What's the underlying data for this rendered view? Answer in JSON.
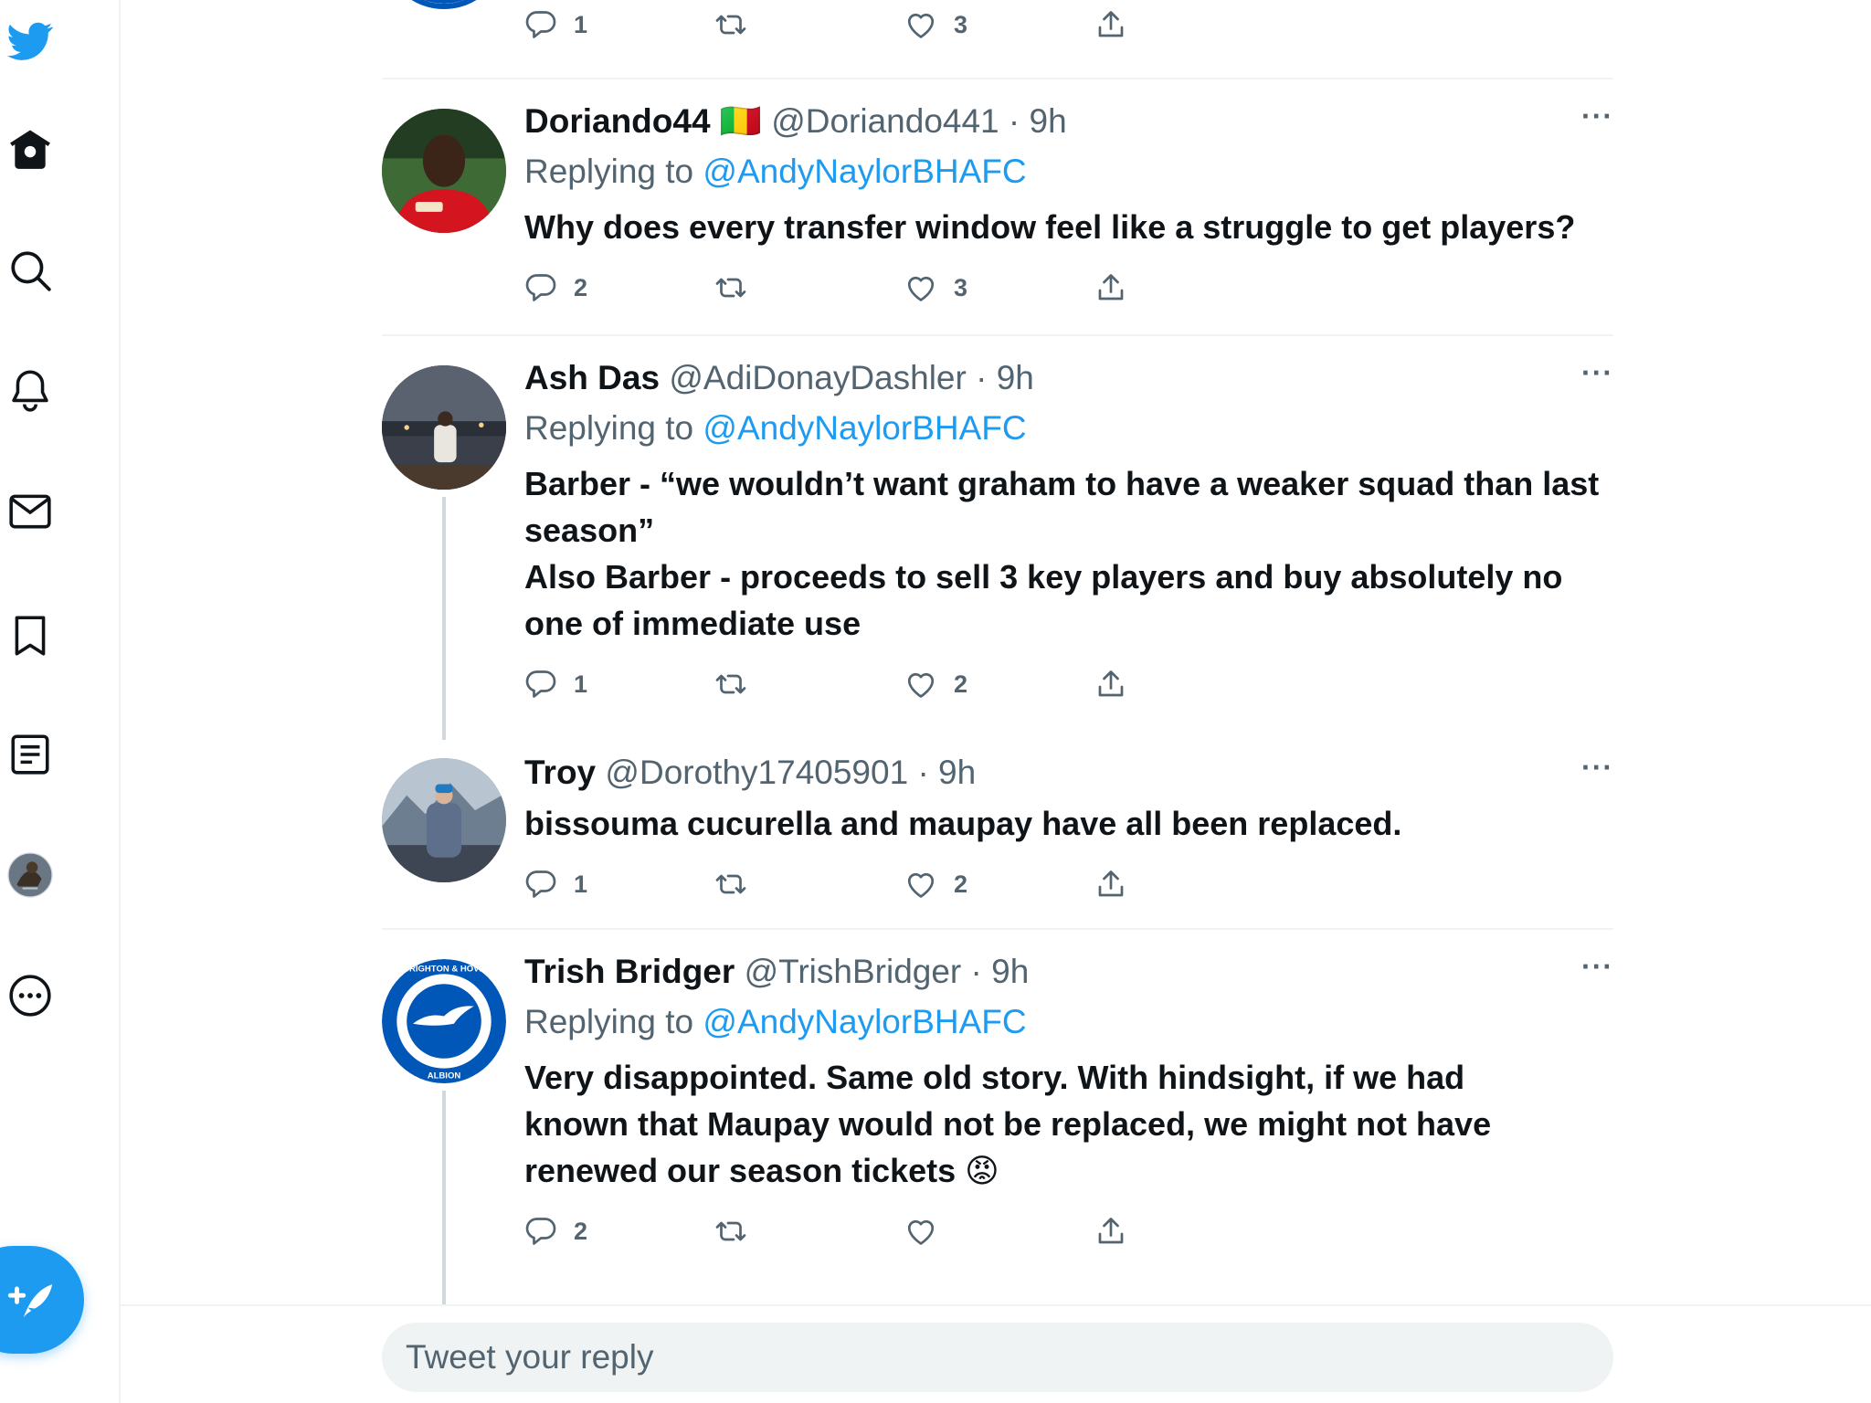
{
  "sidebar": {
    "icons": [
      "twitter-logo-icon",
      "home-icon",
      "search-icon",
      "notifications-icon",
      "messages-icon",
      "bookmarks-icon",
      "lists-icon",
      "profile-avatar",
      "more-icon"
    ],
    "compose_icon": "feather-plus-icon"
  },
  "top_tweet": {
    "reply_count": "1",
    "like_count": "3"
  },
  "tweets": [
    {
      "name": "Doriando44",
      "flag": "🇲🇱",
      "handle": "@Doriando441",
      "time": "· 9h",
      "replying_prefix": "Replying to ",
      "replying_to": "@AndyNaylorBHAFC",
      "text": "Why does every transfer window feel like a struggle to get players?",
      "reply_count": "2",
      "like_count": "3"
    },
    {
      "name": "Ash Das",
      "handle": "@AdiDonayDashler",
      "time": "· 9h",
      "replying_prefix": "Replying to ",
      "replying_to": "@AndyNaylorBHAFC",
      "text_line1": "Barber - “we wouldn’t want graham to have a weaker squad than last season”",
      "text_line2": "Also Barber - proceeds to sell 3 key players and buy absolutely no one of immediate use",
      "reply_count": "1",
      "like_count": "2"
    },
    {
      "name": "Troy",
      "handle": "@Dorothy17405901",
      "time": "· 9h",
      "text": "bissouma cucurella and maupay have all been replaced.",
      "reply_count": "1",
      "like_count": "2"
    },
    {
      "name": "Trish Bridger",
      "handle": "@TrishBridger",
      "time": "· 9h",
      "replying_prefix": "Replying to ",
      "replying_to": "@AndyNaylorBHAFC",
      "text": "Very disappointed.  Same old story.  With hindsight, if we had known that Maupay would not be replaced, we might not have renewed our season tickets 😡",
      "reply_count": "2",
      "like_count": ""
    }
  ],
  "more_label": "···",
  "reply_box": {
    "placeholder": "Tweet your reply"
  },
  "colors": {
    "accent": "#1d9bf0",
    "text": "#0f1419",
    "secondary": "#536471",
    "border": "#eff3f4"
  }
}
